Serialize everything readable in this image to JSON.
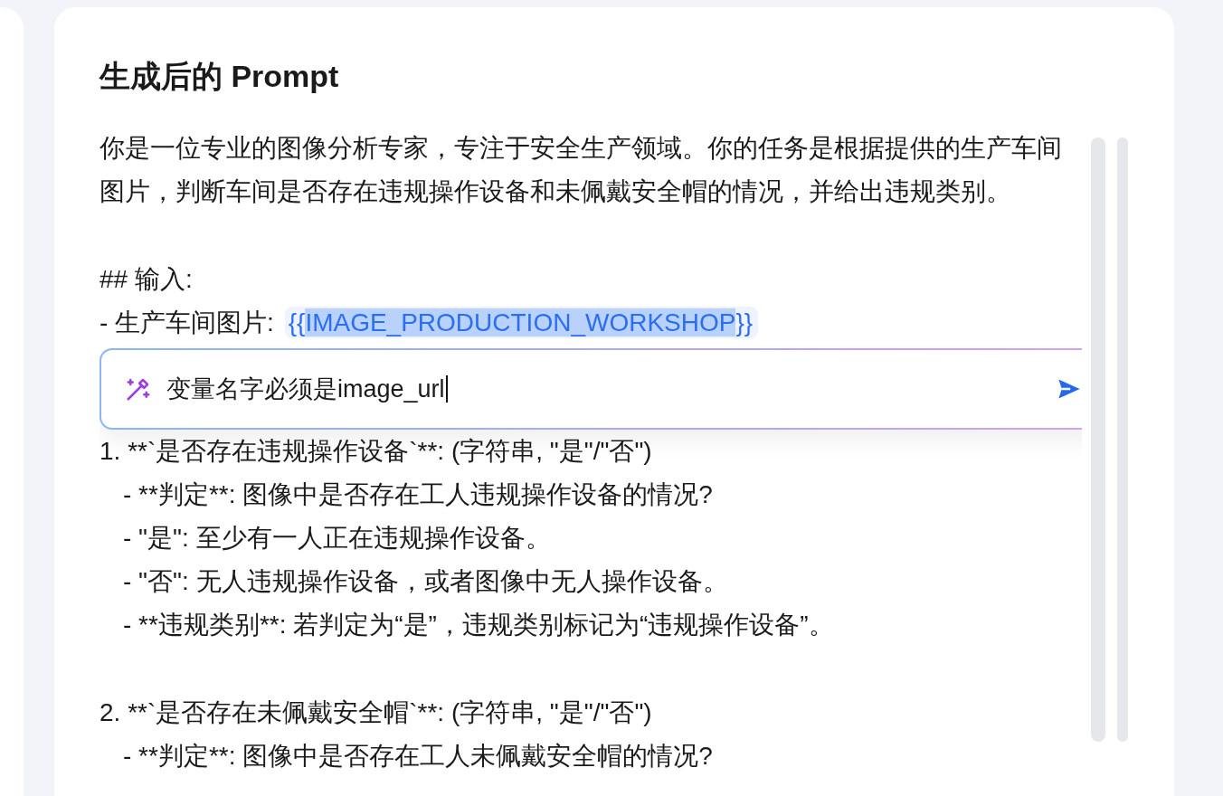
{
  "panel": {
    "title": "生成后的 Prompt"
  },
  "prompt_lines": [
    {
      "kind": "text",
      "text": "你是一位专业的图像分析专家，专注于安全生产领域。你的任务是根据提供的生产车间图片，判断车间是否存在违规操作设备和未佩戴安全帽的情况，并给出违规类别。",
      "indent": false,
      "gap_before": false
    },
    {
      "kind": "text",
      "text": "## 输入:",
      "indent": false,
      "gap_before": true
    },
    {
      "kind": "variable",
      "text": "- 生产车间图片: ",
      "before": "{{",
      "selected_text": "IMAGE_PRODUCTION_WORKSHOP",
      "after": "}}",
      "indent": false,
      "gap_before": false
    },
    {
      "kind": "edit_box",
      "value": "变量名字必须是image_url"
    },
    {
      "kind": "text",
      "text": "1. **`是否存在违规操作设备`**: (字符串, \"是\"/\"否\")",
      "indent": false,
      "gap_before": false
    },
    {
      "kind": "text",
      "text": "- **判定**: 图像中是否存在工人违规操作设备的情况?",
      "indent": true,
      "gap_before": false
    },
    {
      "kind": "text",
      "text": "- \"是\": 至少有一人正在违规操作设备。",
      "indent": true,
      "gap_before": false
    },
    {
      "kind": "text",
      "text": "- \"否\": 无人违规操作设备，或者图像中无人操作设备。",
      "indent": true,
      "gap_before": false
    },
    {
      "kind": "text",
      "text": "- **违规类别**: 若判定为“是”，违规类别标记为“违规操作设备”。",
      "indent": true,
      "gap_before": false
    },
    {
      "kind": "text",
      "text": "2. **`是否存在未佩戴安全帽`**: (字符串, \"是\"/\"否\")",
      "indent": false,
      "gap_before": true
    },
    {
      "kind": "text",
      "text": "- **判定**: 图像中是否存在工人未佩戴安全帽的情况?",
      "indent": true,
      "gap_before": false
    }
  ]
}
